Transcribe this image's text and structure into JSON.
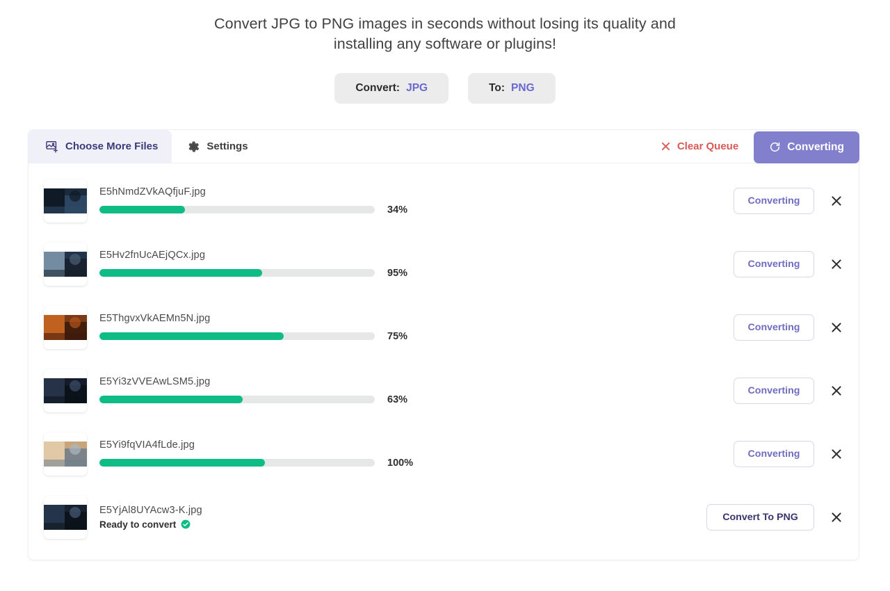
{
  "headline": "Convert JPG to PNG images in seconds without losing its quality and installing any software or plugins!",
  "selector": {
    "from": {
      "label": "Convert:",
      "value": "JPG"
    },
    "to": {
      "label": "To:",
      "value": "PNG"
    }
  },
  "toolbar": {
    "choose_more_files": "Choose More Files",
    "settings": "Settings",
    "clear_queue": "Clear Queue",
    "converting": "Converting"
  },
  "colors": {
    "accent_purple": "#8280cc",
    "link_purple": "#6b68cf",
    "progress_green": "#0fbc86",
    "danger_red": "#d75a57",
    "chip_gray": "#ececec",
    "track_gray": "#e6e8e8"
  },
  "files": [
    {
      "name": "E5hNmdZVkAQfjuF.jpg",
      "percent_label": "34%",
      "fill": 31,
      "status": "progress",
      "action": "Converting",
      "thumb": [
        "#1b2a3d",
        "#0d1520",
        "#2f4a66",
        "#101a26"
      ]
    },
    {
      "name": "E5Hv2fnUcAEjQCx.jpg",
      "percent_label": "95%",
      "fill": 59,
      "status": "progress",
      "action": "Converting",
      "thumb": [
        "#22344b",
        "#8fa9bd",
        "#16202c",
        "#4a6073"
      ]
    },
    {
      "name": "E5ThgvxVkAEMn5N.jpg",
      "percent_label": "75%",
      "fill": 67,
      "status": "progress",
      "action": "Converting",
      "thumb": [
        "#7a3a18",
        "#d96f22",
        "#3a1a0c",
        "#b5541b"
      ]
    },
    {
      "name": "E5Yi3zVVEAwLSM5.jpg",
      "percent_label": "63%",
      "fill": 52,
      "status": "progress",
      "action": "Converting",
      "thumb": [
        "#141c2b",
        "#2b3a52",
        "#0b1018",
        "#3d4f6b"
      ]
    },
    {
      "name": "E5Yi9fqVIA4fLde.jpg",
      "percent_label": "100%",
      "fill": 60,
      "status": "progress",
      "action": "Converting",
      "thumb": [
        "#c9a47a",
        "#e8d6b8",
        "#6f7f8c",
        "#a9b7bf"
      ]
    },
    {
      "name": "E5YjAl8UYAcw3-K.jpg",
      "ready_text": "Ready to convert",
      "status": "ready",
      "action": "Convert To PNG",
      "thumb": [
        "#16202e",
        "#2a3c56",
        "#0c1219",
        "#475d79"
      ]
    }
  ]
}
